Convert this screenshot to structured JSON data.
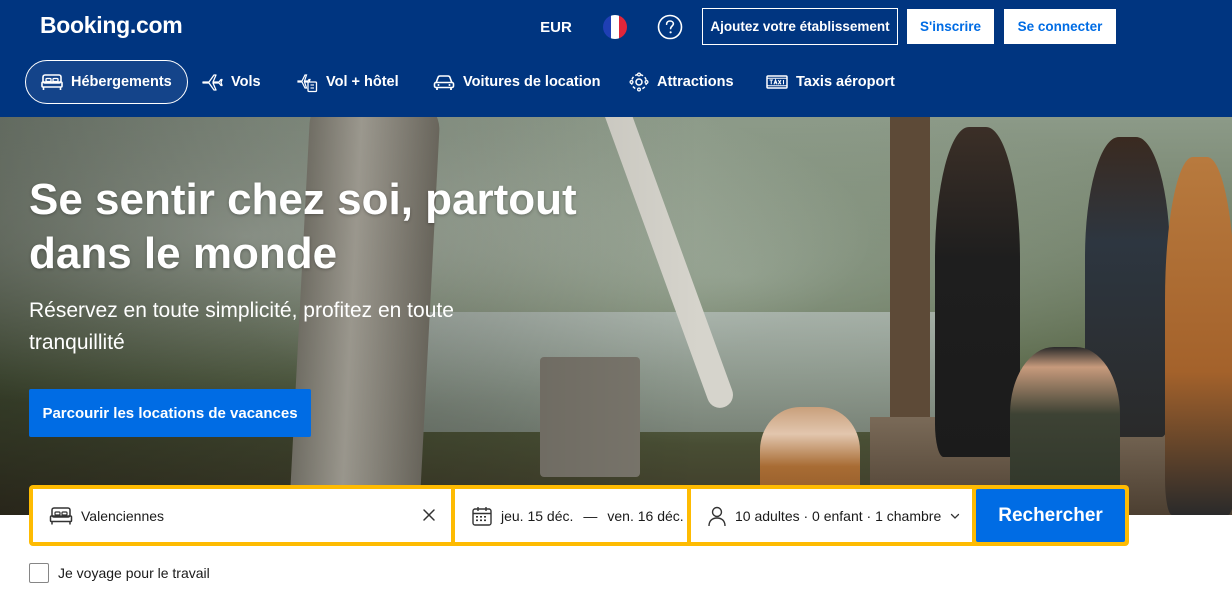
{
  "header": {
    "logo": "Booking.com",
    "currency": "EUR",
    "flag_icon": "france-flag-icon",
    "help_icon": "question-circle-icon",
    "list_property": "Ajoutez votre établissement",
    "register": "S'inscrire",
    "sign_in": "Se connecter",
    "colors": {
      "brand": "#003580",
      "accent": "#006ce4",
      "search_border": "#febb02"
    }
  },
  "nav": [
    {
      "label": "Hébergements",
      "icon": "bed-icon",
      "active": true
    },
    {
      "label": "Vols",
      "icon": "plane-icon"
    },
    {
      "label": "Vol + hôtel",
      "icon": "flight-hotel-icon"
    },
    {
      "label": "Voitures de location",
      "icon": "car-icon"
    },
    {
      "label": "Attractions",
      "icon": "attractions-icon"
    },
    {
      "label": "Taxis aéroport",
      "icon": "taxi-icon"
    }
  ],
  "hero": {
    "title": "Se sentir chez soi, partout dans le monde",
    "subtitle": "Réservez en toute simplicité, profitez en toute tranquillité",
    "cta": "Parcourir les locations de vacances"
  },
  "search": {
    "destination": "Valenciennes",
    "check_in": "jeu. 15 déc.",
    "separator": "—",
    "check_out": "ven. 16 déc.",
    "guests": "10 adultes · 0 enfant · 1 chambre",
    "submit": "Rechercher"
  },
  "work_travel": {
    "label": "Je voyage pour le travail",
    "checked": false
  }
}
